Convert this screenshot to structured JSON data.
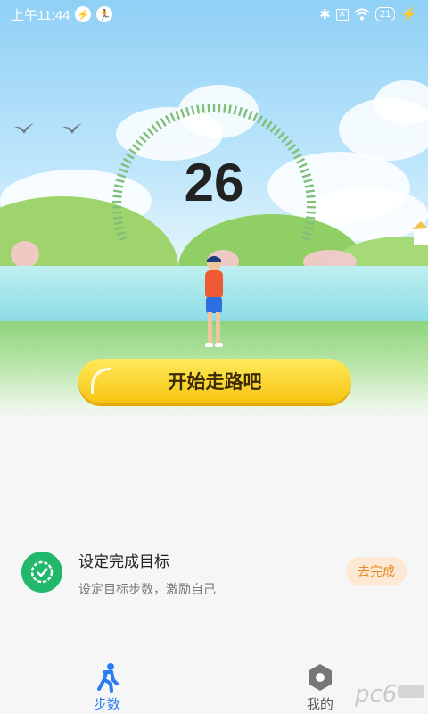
{
  "status_bar": {
    "time": "上午11:44",
    "battery": "21"
  },
  "gauge": {
    "steps": "26"
  },
  "start_button": {
    "label": "开始走路吧"
  },
  "task": {
    "title": "设定完成目标",
    "description": "设定目标步数，激励自己",
    "action_label": "去完成"
  },
  "bottom_nav": {
    "items": [
      {
        "label": "步数",
        "icon": "walker-icon",
        "active": true
      },
      {
        "label": "我的",
        "icon": "hexagon-icon",
        "active": false
      }
    ]
  },
  "colors": {
    "accent_blue": "#2a7cf2",
    "task_green": "#22b86c",
    "start_yellow": "#f6c412",
    "action_orange": "#e48a2a"
  }
}
